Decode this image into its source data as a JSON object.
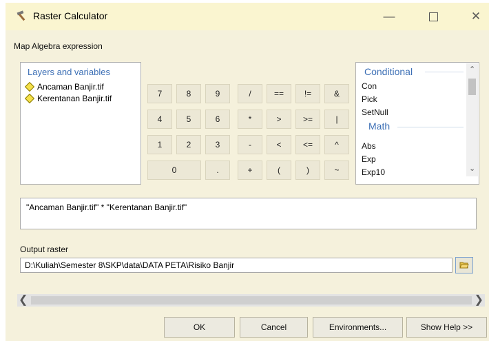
{
  "window": {
    "title": "Raster Calculator"
  },
  "section_label": "Map Algebra expression",
  "layers": {
    "title": "Layers and variables",
    "items": [
      "Ancaman Banjir.tif",
      "Kerentanan Banjir.tif"
    ]
  },
  "keypad": {
    "row1": [
      "7",
      "8",
      "9",
      "/",
      "==",
      "!=",
      "&"
    ],
    "row2": [
      "4",
      "5",
      "6",
      "*",
      ">",
      ">=",
      "|"
    ],
    "row3": [
      "1",
      "2",
      "3",
      "-",
      "<",
      "<=",
      "^"
    ],
    "row4": [
      "0",
      ".",
      "+",
      "(",
      ")",
      "~"
    ]
  },
  "functions": {
    "group1": "Conditional",
    "group1_items": [
      "Con",
      "Pick",
      "SetNull"
    ],
    "group2": "Math",
    "group2_items": [
      "Abs",
      "Exp",
      "Exp10"
    ]
  },
  "expression": "\"Ancaman Banjir.tif\" * \"Kerentanan Banjir.tif\"",
  "output": {
    "label": "Output raster",
    "value": "D:\\Kuliah\\Semester 8\\SKP\\data\\DATA PETA\\Risiko Banjir"
  },
  "buttons": {
    "ok": "OK",
    "cancel": "Cancel",
    "environments": "Environments...",
    "help": "Show Help >>"
  },
  "colors": {
    "titlebar": "#faf5d0",
    "client": "#f5f1dc",
    "heading_blue": "#3c6fb5"
  }
}
